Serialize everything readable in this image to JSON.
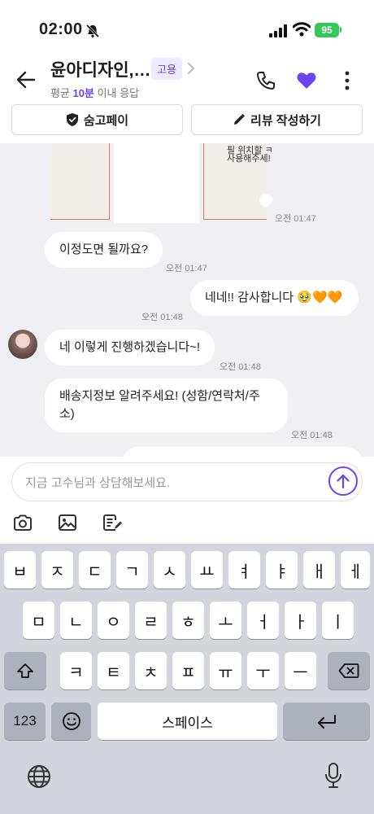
{
  "status_bar": {
    "time": "02:00",
    "battery": "95"
  },
  "header": {
    "title": "윤아디자인,…",
    "badge": "고용",
    "response_prefix": "평균",
    "response_highlight": "10분",
    "response_suffix": "이내 응답"
  },
  "actions": {
    "pay_label": "숨고페이",
    "review_label": "리뷰 작성하기"
  },
  "attachment_text": {
    "line1": "필 위치할 ㅋ",
    "line2": "사용해주세!"
  },
  "messages": [
    {
      "time": "오전 01:47"
    },
    {
      "text": "이정도면 될까요?",
      "time": "오전 01:47"
    },
    {
      "text": "네네!! 감사합니다 🥹🧡🧡",
      "time": "오전 01:48"
    },
    {
      "text": "네 이렇게 진행하겠습니다~!",
      "time": "오전 01:48"
    },
    {
      "text_line1": "배송지정보 알려주세요! (성함/연락처/주",
      "text_line2": "소)",
      "time": "오전 01:48"
    }
  ],
  "input": {
    "placeholder": "지금 고수님과 상담해보세요."
  },
  "keyboard": {
    "row1": [
      "ㅂ",
      "ㅈ",
      "ㄷ",
      "ㄱ",
      "ㅅ",
      "ㅛ",
      "ㅕ",
      "ㅑ",
      "ㅐ",
      "ㅔ"
    ],
    "row2": [
      "ㅁ",
      "ㄴ",
      "ㅇ",
      "ㄹ",
      "ㅎ",
      "ㅗ",
      "ㅓ",
      "ㅏ",
      "ㅣ"
    ],
    "row3": [
      "ㅋ",
      "ㅌ",
      "ㅊ",
      "ㅍ",
      "ㅠ",
      "ㅜ",
      "ㅡ"
    ],
    "numbers_label": "123",
    "space_label": "스페이스"
  },
  "colors": {
    "accent": "#6b44f0",
    "chat_bg": "#f0f0f4",
    "keyboard_bg": "#d3d5dc"
  }
}
